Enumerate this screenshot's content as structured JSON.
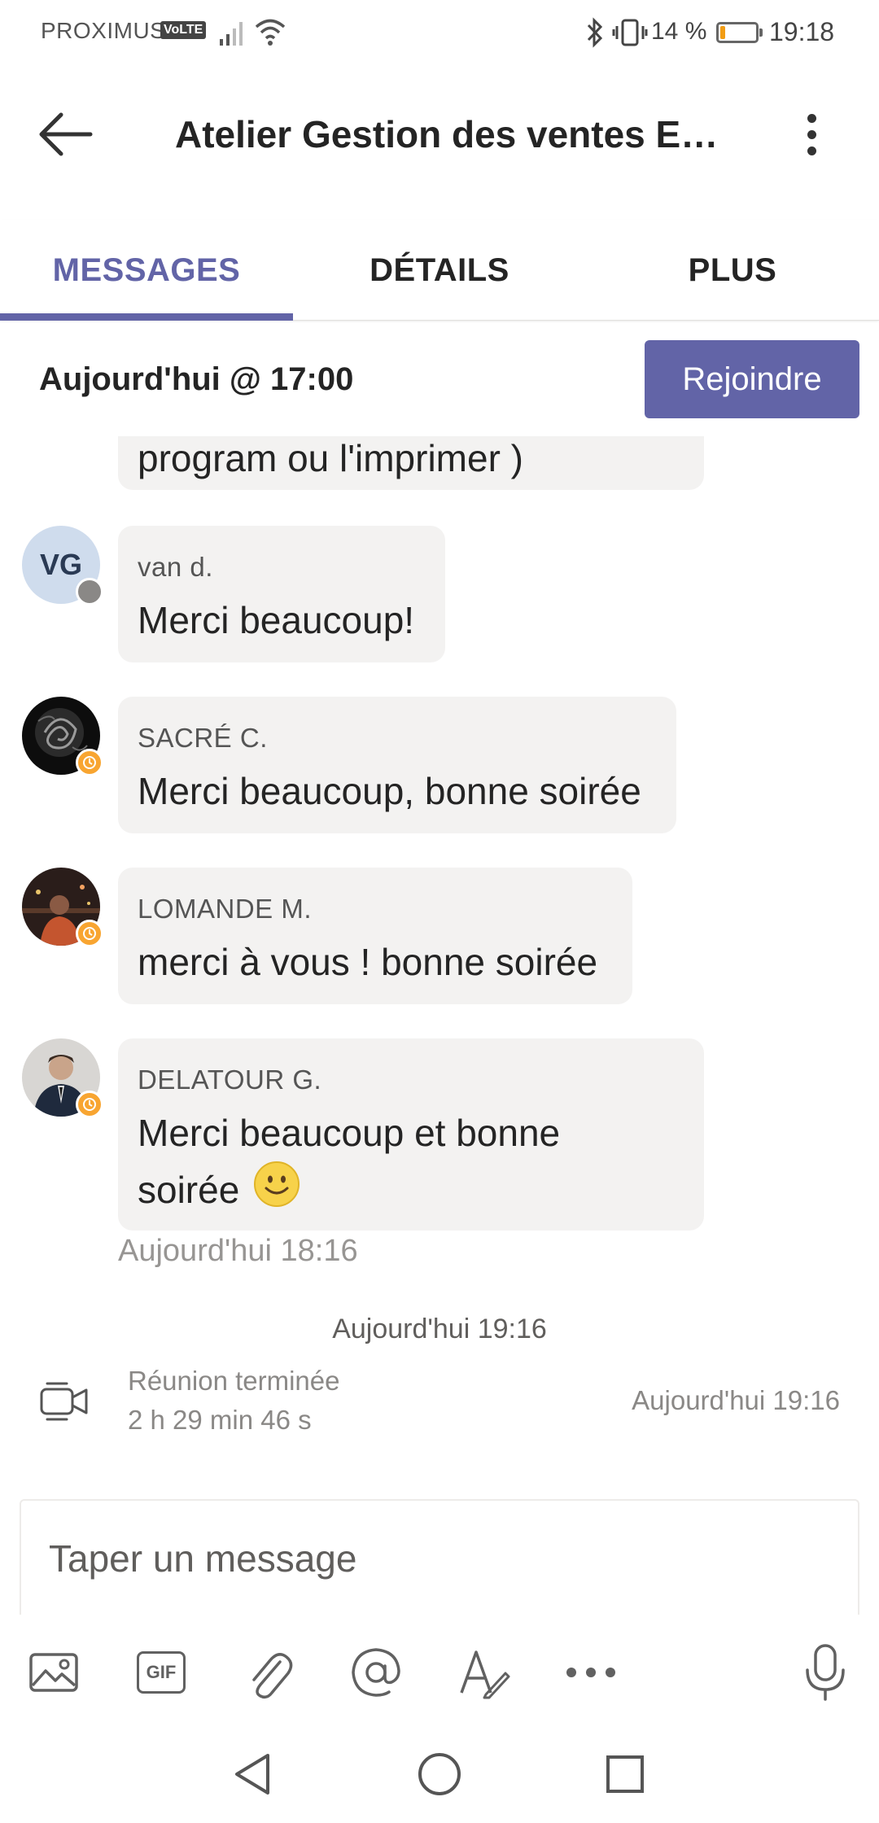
{
  "status_bar": {
    "carrier": "PROXIMUS.",
    "volte": "VoLTE",
    "battery_percent": "14 %",
    "time": "19:18",
    "battery_level": 0.14,
    "battery_color": "#f29d14"
  },
  "header": {
    "title": "Atelier Gestion des ventes Ep…",
    "back_icon": "arrow-left-icon",
    "more_icon": "more-vertical-icon"
  },
  "tabs": [
    {
      "label": "MESSAGES",
      "active": true
    },
    {
      "label": "DÉTAILS",
      "active": false
    },
    {
      "label": "PLUS",
      "active": false
    }
  ],
  "meeting_bar": {
    "time_label": "Aujourd'hui @ 17:00",
    "join_label": "Rejoindre"
  },
  "chat": {
    "partial_message": "program ou l'imprimer )",
    "messages": [
      {
        "author": "van d.",
        "initials": "VG",
        "text": "Merci beaucoup!",
        "presence": "offline"
      },
      {
        "author": "SACRÉ C.",
        "text": "Merci beaucoup, bonne soirée",
        "presence": "away"
      },
      {
        "author": "LOMANDE M.",
        "text": "merci à vous ! bonne soirée",
        "presence": "away"
      },
      {
        "author": "DELATOUR G.",
        "text_line1": "Merci beaucoup et bonne",
        "text_line2": "soirée",
        "presence": "away",
        "emoji": "smile-emoji-icon"
      }
    ],
    "last_timestamp": "Aujourd'hui 18:16",
    "divider_timestamp": "Aujourd'hui 19:16",
    "meeting_ended": {
      "title": "Réunion terminée",
      "duration": "2 h 29 min 46 s",
      "time": "Aujourd'hui 19:16"
    }
  },
  "compose": {
    "placeholder": "Taper un message"
  },
  "toolbar": {
    "gif_label": "GIF",
    "icons": [
      "image-icon",
      "gif-icon",
      "attach-icon",
      "mention-icon",
      "format-icon",
      "more-horizontal-icon",
      "microphone-icon"
    ]
  },
  "colors": {
    "accent": "#6264a7",
    "bubble": "#f3f2f1",
    "away": "#f8a531"
  }
}
